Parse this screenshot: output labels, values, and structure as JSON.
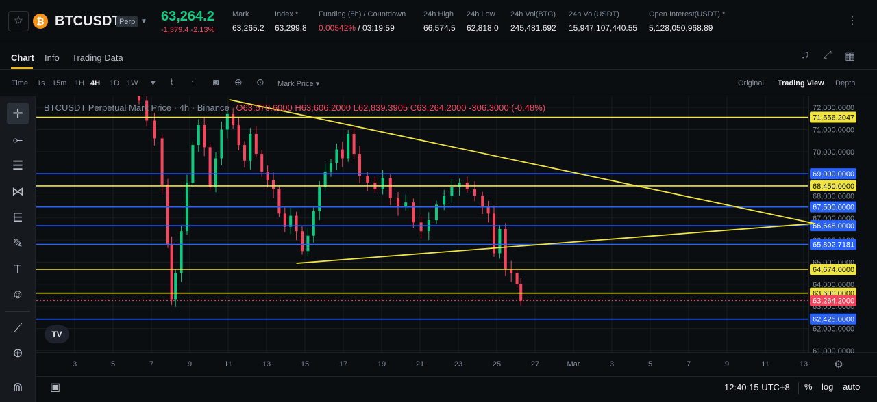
{
  "header": {
    "symbol": "BTCUSDT",
    "contract": "Perp",
    "last_price": "63,264.2",
    "change": "-1,379.4  -2.13%",
    "stats": [
      {
        "label": "Mark",
        "value": "63,265.2"
      },
      {
        "label": "Index *",
        "value": "63,299.8"
      },
      {
        "label": "Funding (8h) / Countdown",
        "value_rate": "0.00542%",
        "value_rest": " / 03:19:59"
      },
      {
        "label": "24h High",
        "value": "66,574.5"
      },
      {
        "label": "24h Low",
        "value": "62,818.0"
      },
      {
        "label": "24h Vol(BTC)",
        "value": "245,481.692"
      },
      {
        "label": "24h Vol(USDT)",
        "value": "15,947,107,440.55"
      },
      {
        "label": "Open Interest(USDT) *",
        "value": "5,128,050,968.89"
      }
    ]
  },
  "tabs": [
    "Chart",
    "Info",
    "Trading Data"
  ],
  "toolbar": {
    "intervals": [
      "Time",
      "1s",
      "15m",
      "1H",
      "4H",
      "1D",
      "1W"
    ],
    "active_interval": "4H",
    "price_type": "Mark Price",
    "views": [
      "Original",
      "Trading View",
      "Depth"
    ],
    "active_view": "Trading View"
  },
  "legend": {
    "title": "BTCUSDT Perpetual Mark Price · 4h · Binance",
    "ohlc": "O63,570.6000 H63,606.2000 L62,839.3905 C63,264.2000 -306.3000 (-0.48%)"
  },
  "footer": {
    "time": "12:40:15 UTC+8",
    "percent": "%",
    "log": "log",
    "auto": "auto"
  },
  "chart_data": {
    "type": "candlestick",
    "title": "BTCUSDT Perpetual Mark Price · 4h · Binance",
    "x_ticks": [
      "3",
      "5",
      "7",
      "9",
      "11",
      "13",
      "15",
      "17",
      "19",
      "21",
      "23",
      "25",
      "27",
      "Mar",
      "3",
      "5",
      "7",
      "9",
      "11",
      "13"
    ],
    "y_ticks": [
      72000,
      71000,
      70000,
      69000,
      68000,
      67000,
      66000,
      65000,
      64000,
      63000,
      62000,
      61000
    ],
    "ylim": [
      60900,
      72500
    ],
    "horizontal_lines": [
      {
        "price": 71556.2047,
        "label": "71,556.2047",
        "color": "#f0e442"
      },
      {
        "price": 69000.0,
        "label": "69,000.0000",
        "color": "#2962ff"
      },
      {
        "price": 68450.0,
        "label": "68,450.0000",
        "color": "#f0e442"
      },
      {
        "price": 67500.0,
        "label": "67,500.0000",
        "color": "#2962ff"
      },
      {
        "price": 66648.0,
        "label": "66,648.0000",
        "color": "#2962ff"
      },
      {
        "price": 65802.7181,
        "label": "65,802.7181",
        "color": "#2962ff"
      },
      {
        "price": 64674.0,
        "label": "64,674.0000",
        "color": "#f0e442"
      },
      {
        "price": 63600.0,
        "label": "63,600.0000",
        "color": "#f0e442"
      },
      {
        "price": 62425.0,
        "label": "62,425.0000",
        "color": "#2962ff"
      }
    ],
    "current_price": {
      "price": 63264.2,
      "label": "63,264.2000",
      "color": "#f6465d"
    },
    "trendlines": [
      {
        "from": {
          "day": 9.2,
          "price": 72350
        },
        "to": {
          "day": 101.5,
          "price": 66750
        },
        "color": "#f0e442"
      },
      {
        "from": {
          "day": 12.7,
          "price": 64950
        },
        "to": {
          "day": 101.5,
          "price": 66750
        },
        "color": "#f0e442"
      }
    ],
    "candles_close_path": [
      [
        4.5,
        72300
      ],
      [
        4.9,
        71400
      ],
      [
        5.3,
        70600
      ],
      [
        5.7,
        68500
      ],
      [
        6.0,
        65800
      ],
      [
        6.2,
        63300
      ],
      [
        6.4,
        64500
      ],
      [
        6.7,
        66400
      ],
      [
        7.0,
        68600
      ],
      [
        7.3,
        70300
      ],
      [
        7.6,
        71200
      ],
      [
        7.9,
        70200
      ],
      [
        8.2,
        68400
      ],
      [
        8.5,
        69700
      ],
      [
        8.8,
        71000
      ],
      [
        9.1,
        71700
      ],
      [
        9.4,
        71200
      ],
      [
        9.7,
        70300
      ],
      [
        10.0,
        69600
      ],
      [
        10.3,
        70800
      ],
      [
        10.6,
        69900
      ],
      [
        10.9,
        69100
      ],
      [
        11.2,
        68700
      ],
      [
        11.5,
        68300
      ],
      [
        11.8,
        67200
      ],
      [
        12.1,
        66600
      ],
      [
        12.4,
        67100
      ],
      [
        12.7,
        66400
      ],
      [
        13.0,
        65500
      ],
      [
        13.3,
        66200
      ],
      [
        13.6,
        67300
      ],
      [
        13.9,
        68400
      ],
      [
        14.2,
        69100
      ],
      [
        14.5,
        69500
      ],
      [
        14.8,
        70100
      ],
      [
        15.1,
        69700
      ],
      [
        15.4,
        70800
      ],
      [
        15.7,
        69900
      ],
      [
        16.0,
        68900
      ],
      [
        16.4,
        68600
      ],
      [
        16.8,
        68300
      ],
      [
        17.2,
        68800
      ],
      [
        17.6,
        67900
      ],
      [
        18.0,
        67500
      ],
      [
        18.4,
        67700
      ],
      [
        18.8,
        66800
      ],
      [
        19.2,
        66400
      ],
      [
        19.6,
        66900
      ],
      [
        20.0,
        67600
      ],
      [
        20.4,
        68000
      ],
      [
        20.8,
        68400
      ],
      [
        21.2,
        68600
      ],
      [
        21.6,
        68300
      ],
      [
        22.0,
        68000
      ],
      [
        22.4,
        67500
      ],
      [
        22.7,
        67200
      ],
      [
        23.0,
        65400
      ],
      [
        23.3,
        66500
      ],
      [
        23.6,
        64700
      ],
      [
        23.9,
        64500
      ],
      [
        24.2,
        64000
      ],
      [
        24.4,
        63264
      ]
    ]
  }
}
